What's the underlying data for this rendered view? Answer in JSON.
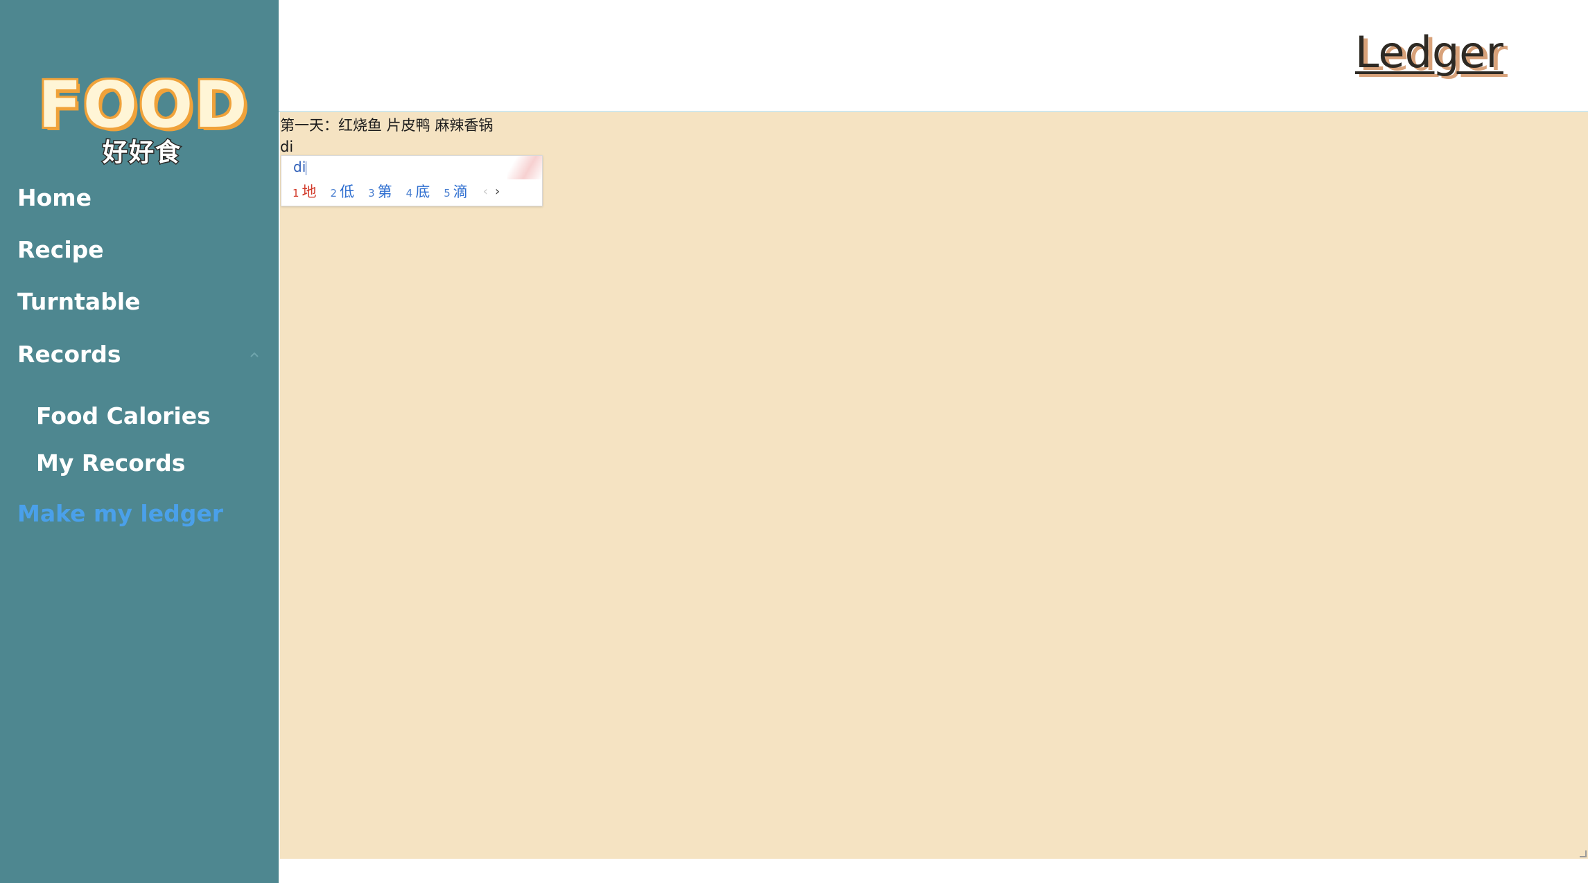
{
  "sidebar": {
    "logo": {
      "title": "FOOD",
      "subtitle": "好好食"
    },
    "nav": {
      "home": "Home",
      "recipe": "Recipe",
      "turntable": "Turntable",
      "records": "Records",
      "food_calories": "Food Calories",
      "my_records": "My Records",
      "make_ledger": "Make my ledger"
    },
    "active_color": "#4aa0ea",
    "background_color": "#4e8790"
  },
  "header": {
    "title": "Ledger"
  },
  "editor": {
    "value": "第一天：红烧鱼 片皮鸭 麻辣香锅\ndi",
    "background_color": "#f5e3c2"
  },
  "ime": {
    "composition": "di",
    "candidates": [
      {
        "num": "1",
        "char": "地"
      },
      {
        "num": "2",
        "char": "低"
      },
      {
        "num": "3",
        "char": "第"
      },
      {
        "num": "4",
        "char": "底"
      },
      {
        "num": "5",
        "char": "滴"
      }
    ],
    "prev_icon": "chevron-left-icon",
    "next_icon": "chevron-right-icon"
  }
}
